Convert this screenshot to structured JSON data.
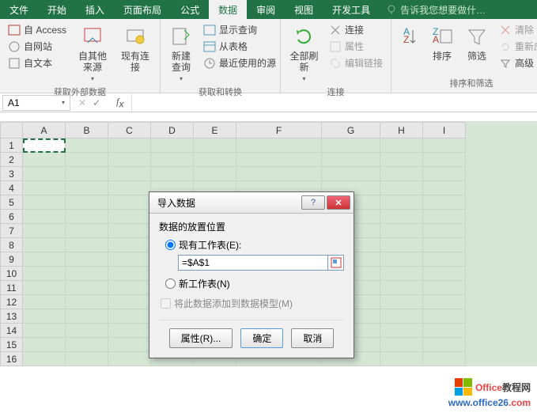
{
  "tabs": {
    "file": "文件",
    "items": [
      "开始",
      "插入",
      "页面布局",
      "公式",
      "数据",
      "审阅",
      "视图",
      "开发工具"
    ],
    "active_index": 4,
    "tell_me": "告诉我您想要做什…"
  },
  "ribbon": {
    "group1": {
      "title": "获取外部数据",
      "access": "自 Access",
      "web": "自网站",
      "text": "自文本",
      "other": "自其他来源",
      "existing": "现有连接"
    },
    "group2": {
      "title": "获取和转换",
      "newquery": "新建\n查询",
      "showquery": "显示查询",
      "fromtable": "从表格",
      "recent": "最近使用的源"
    },
    "group3": {
      "title": "连接",
      "refresh": "全部刷新",
      "conn": "连接",
      "prop": "属性",
      "editlink": "编辑链接"
    },
    "group4": {
      "title": "排序和筛选",
      "sort": "排序",
      "filter": "筛选",
      "clear": "清除",
      "reapply": "重新应",
      "advanced": "高级"
    }
  },
  "namebox": "A1",
  "columns": [
    "A",
    "B",
    "C",
    "D",
    "E",
    "F",
    "G",
    "H",
    "I"
  ],
  "rows": [
    "1",
    "2",
    "3",
    "4",
    "5",
    "6",
    "7",
    "8",
    "9",
    "10",
    "11",
    "12",
    "13",
    "14",
    "15",
    "16"
  ],
  "dialog": {
    "title": "导入数据",
    "section": "数据的放置位置",
    "radio_existing": "现有工作表(E):",
    "ref_value": "=$A$1",
    "radio_new": "新工作表(N)",
    "checkbox": "将此数据添加到数据模型(M)",
    "btn_props": "属性(R)...",
    "btn_ok": "确定",
    "btn_cancel": "取消"
  },
  "watermark": {
    "brand1": "Office",
    "brand2": "教程网",
    "url_main": "www.office26",
    "url_ext": ".com"
  }
}
